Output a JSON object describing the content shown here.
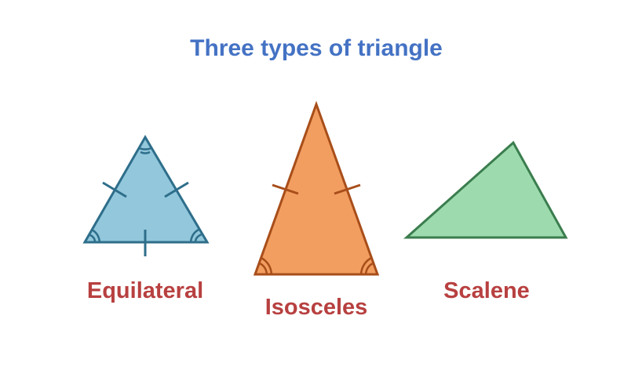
{
  "title": "Three types of triangle",
  "colors": {
    "title": "#4472c4",
    "label": "#b84040",
    "equilateral_fill": "#92c7dc",
    "equilateral_stroke": "#2e6e8a",
    "isosceles_fill": "#f29e60",
    "isosceles_stroke": "#a84e1a",
    "scalene_fill": "#9ddbae",
    "scalene_stroke": "#3b7d4e"
  },
  "shapes": {
    "equilateral": {
      "label": "Equilateral"
    },
    "isosceles": {
      "label": "Isosceles"
    },
    "scalene": {
      "label": "Scalene"
    }
  }
}
